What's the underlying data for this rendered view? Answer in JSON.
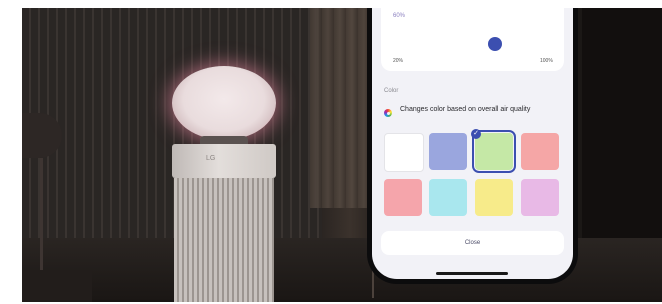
{
  "brightness": {
    "value_label": "60%",
    "min_label": "20%",
    "max_label": "100%"
  },
  "color_section": {
    "title": "Color",
    "auto_option_label": "Changes color based on overall air quality",
    "check_glyph": "✓",
    "swatches": [
      {
        "name": "white",
        "color": "#ffffff",
        "selected": false
      },
      {
        "name": "blue",
        "color": "#9aa6de",
        "selected": false
      },
      {
        "name": "green",
        "color": "#c5e8a6",
        "selected": true
      },
      {
        "name": "red",
        "color": "#f5a6a6",
        "selected": false
      },
      {
        "name": "coral",
        "color": "#f5a5ab",
        "selected": false
      },
      {
        "name": "cyan",
        "color": "#a9e7ee",
        "selected": false
      },
      {
        "name": "yellow",
        "color": "#f7eb8a",
        "selected": false
      },
      {
        "name": "lavender",
        "color": "#e8b9e6",
        "selected": false
      }
    ]
  },
  "close_button": {
    "label": "Close"
  },
  "purifier": {
    "logo_text": "LG"
  },
  "colors": {
    "accent": "#3c4fb0",
    "ring_glow": "#f0a7b6"
  }
}
